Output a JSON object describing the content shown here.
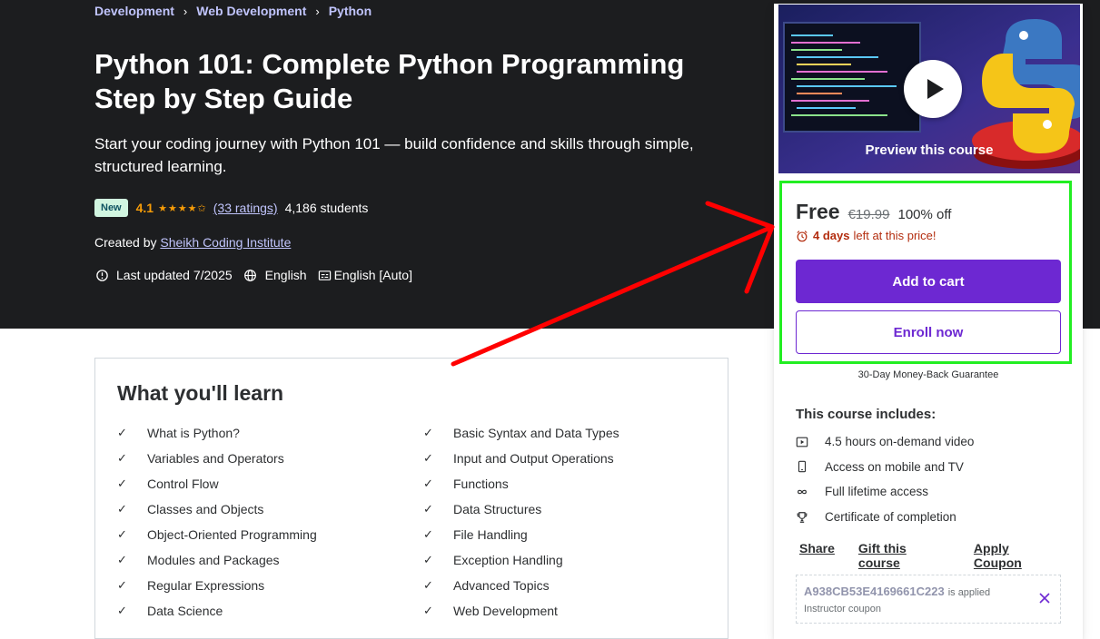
{
  "breadcrumb": [
    "Development",
    "Web Development",
    "Python"
  ],
  "breadcrumb_separator": "›",
  "course": {
    "title": "Python 101: Complete Python Programming Step by Step Guide",
    "subtitle": "Start your coding journey with Python 101 — build confidence and skills through simple, structured learning.",
    "badge": "New",
    "rating": "4.1",
    "stars": "★★★★✩",
    "ratings_count": "(33 ratings)",
    "students": "4,186 students",
    "created_by_label": "Created by",
    "creator": "Sheikh Coding Institute",
    "last_updated": "Last updated 7/2025",
    "language": "English",
    "captions": "English [Auto]"
  },
  "learn": {
    "title": "What you'll learn",
    "items": [
      "What is Python?",
      "Basic Syntax and Data Types",
      "Variables and Operators",
      "Input and Output Operations",
      "Control Flow",
      "Functions",
      "Classes and Objects",
      "Data Structures",
      "Object-Oriented Programming",
      "File Handling",
      "Modules and Packages",
      "Exception Handling",
      "Regular Expressions",
      "Advanced Topics",
      "Data Science",
      "Web Development"
    ]
  },
  "sidebar": {
    "preview_label": "Preview this course",
    "price_current": "Free",
    "price_original": "€19.99",
    "discount": "100% off",
    "timer_bold": "4 days",
    "timer_rest": "left at this price!",
    "add_to_cart": "Add to cart",
    "enroll_now": "Enroll now",
    "guarantee": "30-Day Money-Back Guarantee",
    "includes_title": "This course includes:",
    "includes": [
      "4.5 hours on-demand video",
      "Access on mobile and TV",
      "Full lifetime access",
      "Certificate of completion"
    ],
    "links": [
      "Share",
      "Gift this course",
      "Apply Coupon"
    ],
    "coupon_code": "A938CB53E4169661C223",
    "coupon_applied": "is applied",
    "coupon_sub": "Instructor coupon"
  },
  "colors": {
    "hero_bg": "#1c1d1f",
    "accent_purple": "#6d28d2",
    "link_lavender": "#c0c4fc",
    "star_orange": "#f69c08",
    "timer_red": "#b32d0f",
    "highlight_green": "#22ee22",
    "annotation_arrow": "#ff0000"
  }
}
